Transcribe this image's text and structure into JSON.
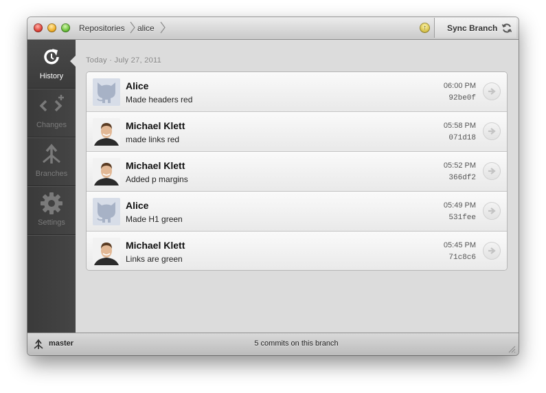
{
  "titlebar": {
    "breadcrumb": [
      "Repositories",
      "alice"
    ],
    "sync_label": "Sync Branch",
    "upload_badge_icon": "up-arrow-icon"
  },
  "sidebar": {
    "items": [
      {
        "label": "History",
        "icon": "history-icon",
        "active": true
      },
      {
        "label": "Changes",
        "icon": "changes-icon",
        "active": false
      },
      {
        "label": "Branches",
        "icon": "branches-icon",
        "active": false
      },
      {
        "label": "Settings",
        "icon": "settings-icon",
        "active": false
      }
    ]
  },
  "history": {
    "date_header": "Today · July 27, 2011",
    "commits": [
      {
        "author": "Alice",
        "message": "Made headers red",
        "time": "06:00 PM",
        "sha": "92be0f",
        "avatar": "octocat"
      },
      {
        "author": "Michael Klett",
        "message": "made links red",
        "time": "05:58 PM",
        "sha": "071d18",
        "avatar": "photo"
      },
      {
        "author": "Michael Klett",
        "message": "Added p margins",
        "time": "05:52 PM",
        "sha": "366df2",
        "avatar": "photo"
      },
      {
        "author": "Alice",
        "message": "Made H1 green",
        "time": "05:49 PM",
        "sha": "531fee",
        "avatar": "octocat"
      },
      {
        "author": "Michael Klett",
        "message": "Links are green",
        "time": "05:45 PM",
        "sha": "71c8c6",
        "avatar": "photo"
      }
    ]
  },
  "statusbar": {
    "branch": "master",
    "commit_count": "5 commits on this branch"
  },
  "colors": {
    "sidebar_bg": "#3f3f3f",
    "content_bg": "#dcdcdc",
    "close": "#e0443a",
    "minimize": "#f0b02a",
    "zoom": "#6bc23a"
  }
}
